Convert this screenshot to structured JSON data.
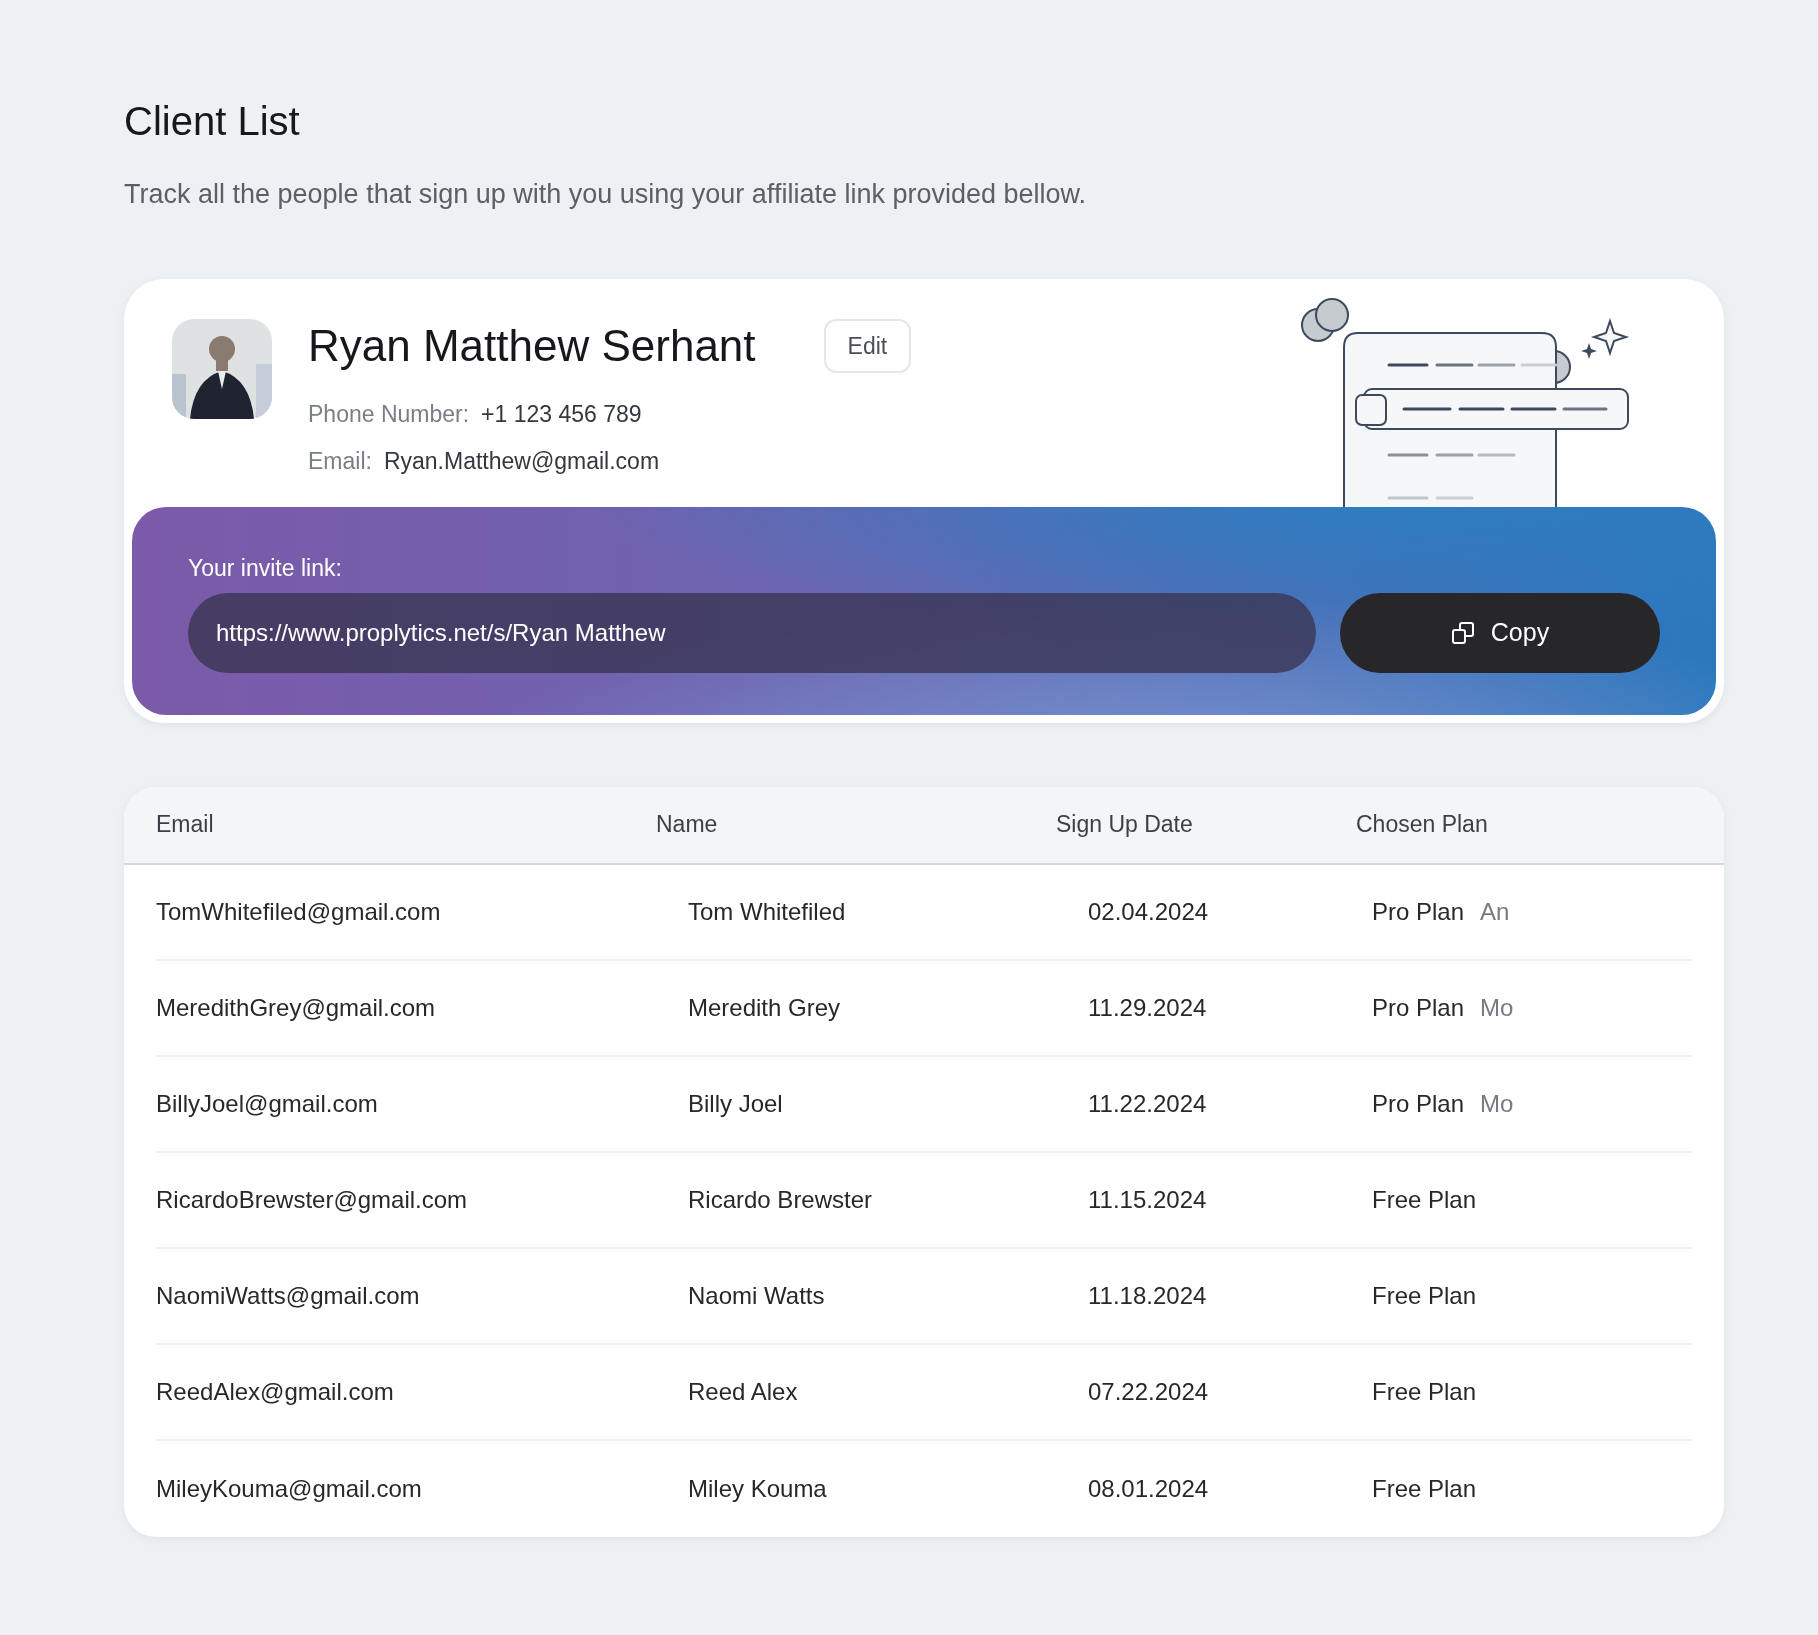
{
  "page": {
    "title": "Client List",
    "subtitle": "Track all the people that sign up with you using your affiliate link provided bellow."
  },
  "profile": {
    "name": "Ryan Matthew Serhant",
    "edit_button": "Edit",
    "phone_label": "Phone Number:",
    "phone": "+1 123 456 789",
    "email_label": "Email:",
    "email": "Ryan.Matthew@gmail.com"
  },
  "invite": {
    "label": "Your invite link:",
    "link": "https://www.proplytics.net/s/Ryan Matthew",
    "copy_button": "Copy"
  },
  "table": {
    "columns": [
      "Email",
      "Name",
      "Sign Up Date",
      "Chosen Plan"
    ],
    "rows": [
      {
        "email": "TomWhitefiled@gmail.com",
        "name": "Tom Whitefiled",
        "date": "02.04.2024",
        "plan": "Pro Plan",
        "billing": "An"
      },
      {
        "email": "MeredithGrey@gmail.com",
        "name": "Meredith Grey",
        "date": "11.29.2024",
        "plan": "Pro Plan",
        "billing": "Mo"
      },
      {
        "email": "BillyJoel@gmail.com",
        "name": "Billy Joel",
        "date": "11.22.2024",
        "plan": "Pro Plan",
        "billing": "Mo"
      },
      {
        "email": "RicardoBrewster@gmail.com",
        "name": "Ricardo Brewster",
        "date": "11.15.2024",
        "plan": "Free Plan"
      },
      {
        "email": "NaomiWatts@gmail.com",
        "name": "Naomi Watts",
        "date": "11.18.2024",
        "plan": "Free Plan"
      },
      {
        "email": "ReedAlex@gmail.com",
        "name": "Reed Alex",
        "date": "07.22.2024",
        "plan": "Free Plan"
      },
      {
        "email": "MileyKouma@gmail.com",
        "name": "Miley Kouma",
        "date": "08.01.2024",
        "plan": "Free Plan"
      }
    ]
  }
}
